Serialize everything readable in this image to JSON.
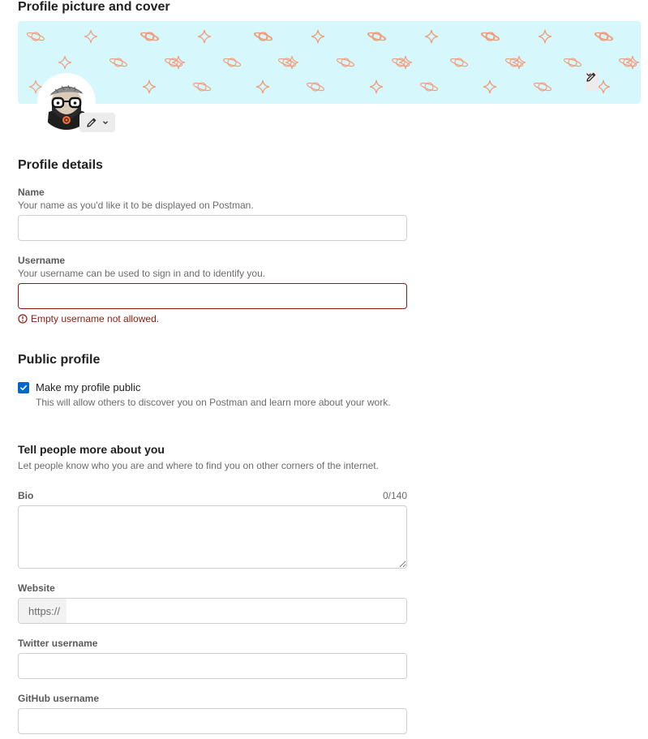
{
  "sections": {
    "cover_title": "Profile picture and cover",
    "profile_details": "Profile details",
    "public_profile": "Public profile",
    "more_about": "Tell people more about you",
    "more_about_desc": "Let people know who you are and where to find you on other corners of the internet."
  },
  "fields": {
    "name": {
      "label": "Name",
      "helper": "Your name as you'd like it to be displayed on Postman.",
      "value": ""
    },
    "username": {
      "label": "Username",
      "helper": "Your username can be used to sign in and to identify you.",
      "value": "",
      "error": "Empty username not allowed."
    },
    "bio": {
      "label": "Bio",
      "counter": "0/140",
      "value": ""
    },
    "website": {
      "label": "Website",
      "prefix": "https://",
      "value": ""
    },
    "twitter": {
      "label": "Twitter username",
      "value": ""
    },
    "github": {
      "label": "GitHub username",
      "value": ""
    }
  },
  "public": {
    "checked": true,
    "label": "Make my profile public",
    "description": "This will allow others to discover you on Postman and learn more about your work."
  },
  "icons": {
    "edit": "pencil-icon",
    "dropdown": "chevron-down-icon",
    "error": "error-circle-icon",
    "check": "check-icon"
  },
  "colors": {
    "cover_bg": "#d6f7fc",
    "cover_pattern": "#f29b7a",
    "error": "#8e1a10",
    "checkbox": "#0265d2"
  }
}
